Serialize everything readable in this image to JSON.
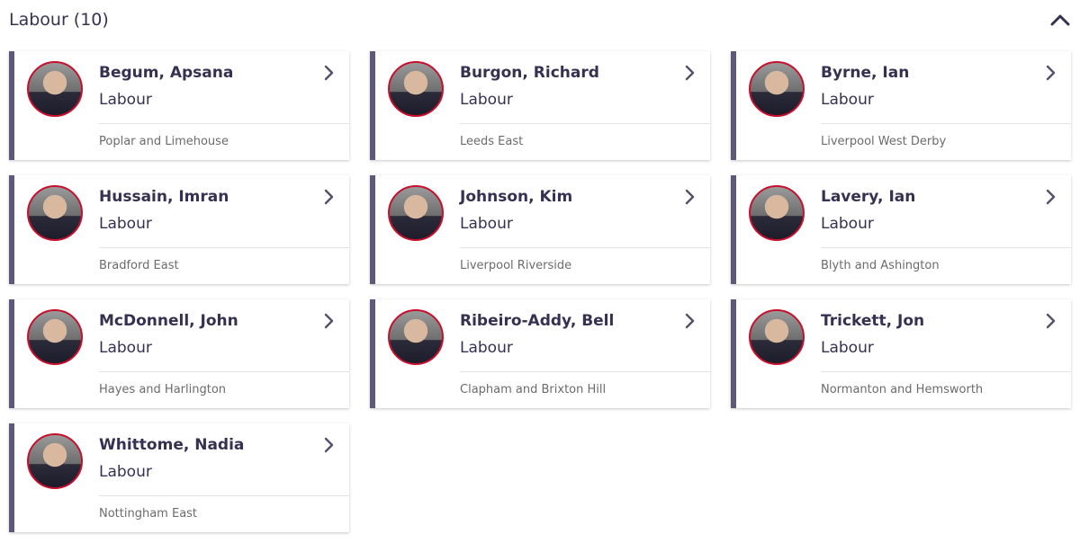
{
  "section": {
    "title": "Labour (10)",
    "collapse_icon": "chevron-up-icon"
  },
  "colors": {
    "text": "#373151",
    "accent_border": "#5e587a",
    "avatar_ring": "#c8102e",
    "muted": "#6b6b6b"
  },
  "members": [
    {
      "name": "Begum, Apsana",
      "party": "Labour",
      "constituency": "Poplar and Limehouse"
    },
    {
      "name": "Burgon, Richard",
      "party": "Labour",
      "constituency": "Leeds East"
    },
    {
      "name": "Byrne, Ian",
      "party": "Labour",
      "constituency": "Liverpool West Derby"
    },
    {
      "name": "Hussain, Imran",
      "party": "Labour",
      "constituency": "Bradford East"
    },
    {
      "name": "Johnson, Kim",
      "party": "Labour",
      "constituency": "Liverpool Riverside"
    },
    {
      "name": "Lavery, Ian",
      "party": "Labour",
      "constituency": "Blyth and Ashington"
    },
    {
      "name": "McDonnell, John",
      "party": "Labour",
      "constituency": "Hayes and Harlington"
    },
    {
      "name": "Ribeiro-Addy, Bell",
      "party": "Labour",
      "constituency": "Clapham and Brixton Hill"
    },
    {
      "name": "Trickett, Jon",
      "party": "Labour",
      "constituency": "Normanton and Hemsworth"
    },
    {
      "name": "Whittome, Nadia",
      "party": "Labour",
      "constituency": "Nottingham East"
    }
  ]
}
